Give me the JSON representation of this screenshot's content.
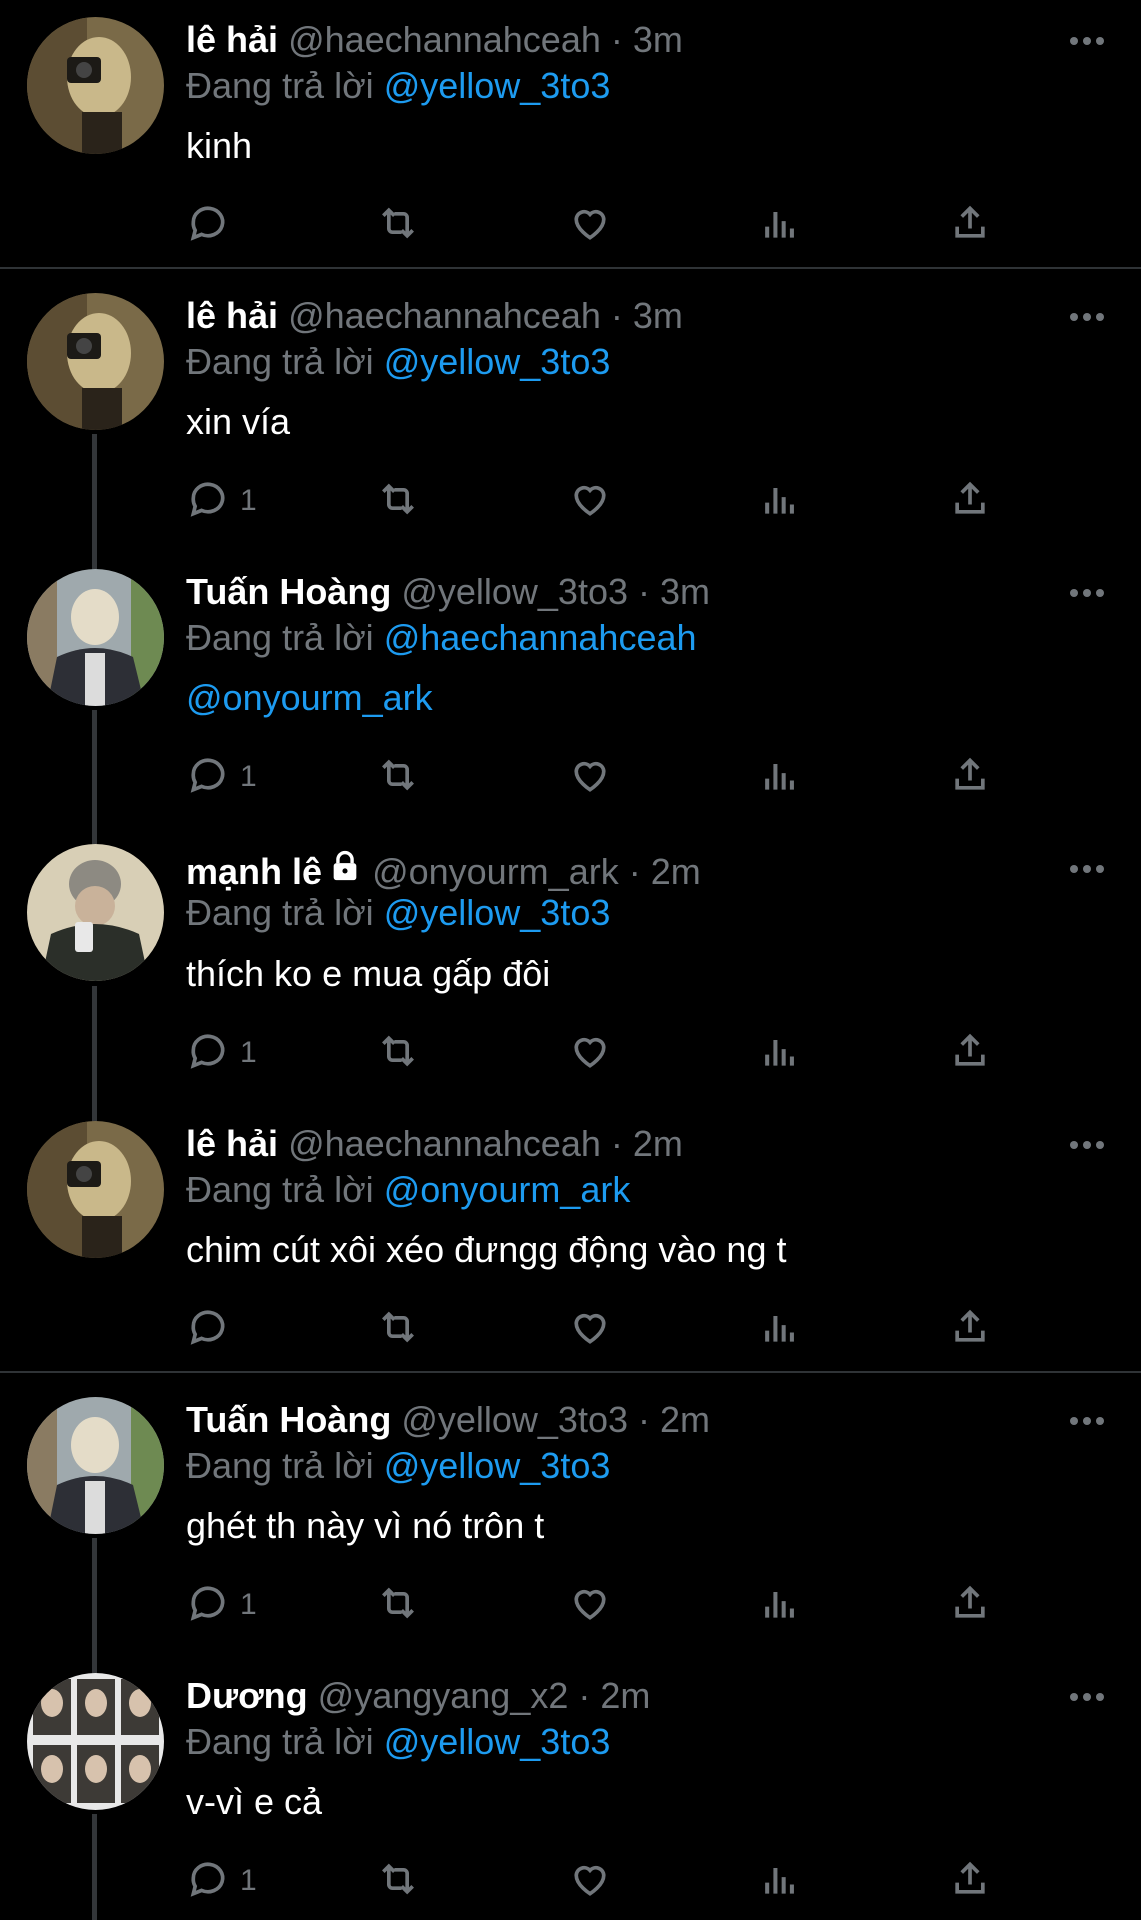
{
  "meta": {
    "separator": "·",
    "reply_prefix": "Đang trả lời"
  },
  "colors": {
    "background": "#000000",
    "text": "#ffffff",
    "muted": "#71767b",
    "accent": "#1d9bf0",
    "divider": "#2f3336"
  },
  "icons": {
    "reply": "reply-icon",
    "retweet": "retweet-icon",
    "like": "heart-icon",
    "views": "bar-chart-icon",
    "share": "share-icon",
    "more": "more-icon",
    "lock": "lock-icon"
  },
  "tweets": [
    {
      "name": "lê hải",
      "handle": "@haechannahceah",
      "time": "3m",
      "reply_to": "@yellow_3to3",
      "text": "kinh",
      "reply_count": ""
    },
    {
      "name": "lê hải",
      "handle": "@haechannahceah",
      "time": "3m",
      "reply_to": "@yellow_3to3",
      "text": "xin vía",
      "reply_count": "1"
    },
    {
      "name": "Tuấn Hoàng",
      "handle": "@yellow_3to3",
      "time": "3m",
      "reply_to": "@haechannahceah",
      "text": "@onyourm_ark",
      "reply_count": "1"
    },
    {
      "name": "mạnh lê",
      "handle": "@onyourm_ark",
      "time": "2m",
      "reply_to": "@yellow_3to3",
      "text": "thích ko e mua gấp đôi",
      "reply_count": "1"
    },
    {
      "name": "lê hải",
      "handle": "@haechannahceah",
      "time": "2m",
      "reply_to": "@onyourm_ark",
      "text": "chim cút xôi xéo đưngg động vào ng t",
      "reply_count": ""
    },
    {
      "name": "Tuấn Hoàng",
      "handle": "@yellow_3to3",
      "time": "2m",
      "reply_to": "@yellow_3to3",
      "text": "ghét th này vì nó trôn t",
      "reply_count": "1"
    },
    {
      "name": "Dương",
      "handle": "@yangyang_x2",
      "time": "2m",
      "reply_to": "@yellow_3to3",
      "text": "v-vì e cả",
      "reply_count": "1"
    }
  ]
}
